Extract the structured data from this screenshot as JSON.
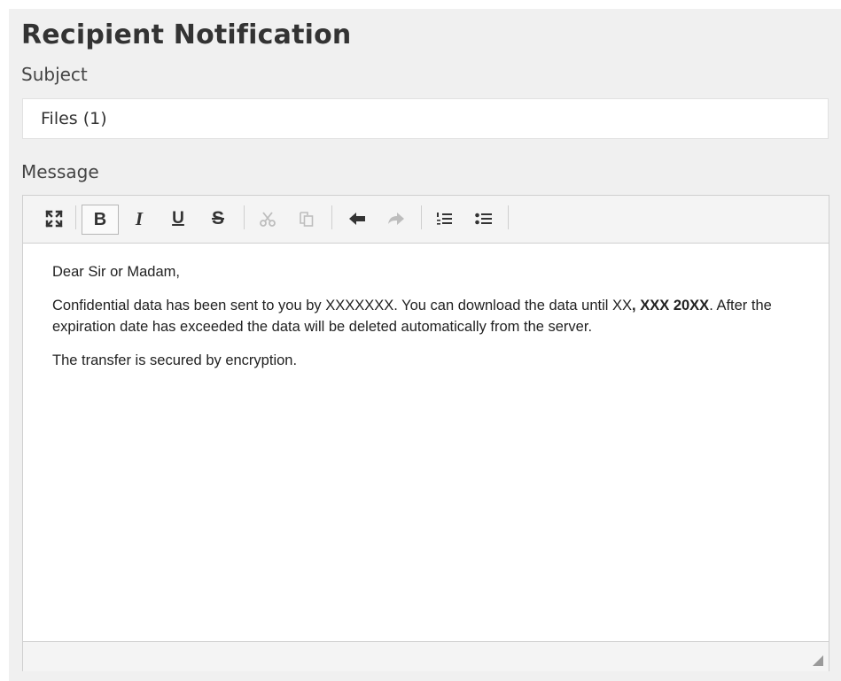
{
  "form": {
    "title": "Recipient Notification",
    "subject_label": "Subject",
    "subject_value": "Files (1)",
    "message_label": "Message"
  },
  "toolbar": {
    "buttons": [
      {
        "name": "fullscreen",
        "icon": "fullscreen-icon",
        "state": "enabled"
      },
      {
        "name": "bold",
        "icon": "bold-icon",
        "label": "B",
        "state": "active"
      },
      {
        "name": "italic",
        "icon": "italic-icon",
        "label": "I",
        "state": "enabled"
      },
      {
        "name": "underline",
        "icon": "underline-icon",
        "label": "U",
        "state": "enabled"
      },
      {
        "name": "strikethrough",
        "icon": "strikethrough-icon",
        "label": "S",
        "state": "enabled"
      },
      {
        "name": "cut",
        "icon": "scissors-icon",
        "state": "disabled"
      },
      {
        "name": "paste",
        "icon": "paste-icon",
        "state": "disabled"
      },
      {
        "name": "undo",
        "icon": "undo-icon",
        "state": "enabled"
      },
      {
        "name": "redo",
        "icon": "redo-icon",
        "state": "disabled"
      },
      {
        "name": "numbered-list",
        "icon": "numbered-list-icon",
        "state": "enabled"
      },
      {
        "name": "bulleted-list",
        "icon": "bulleted-list-icon",
        "state": "enabled"
      }
    ]
  },
  "message": {
    "greeting": "Dear Sir or Madam,",
    "body_part1": "Confidential data has been sent to you by XXXXXXX. You can download the data until XX",
    "body_bold": ", XXX 20XX",
    "body_part2": ". After the expiration date has exceeded the data will be deleted automatically from the server.",
    "closing": "The transfer is secured by encryption."
  },
  "colors": {
    "panel_background": "#f0f0f0",
    "toolbar_background": "#f4f4f4",
    "disabled_icon": "#bdbdbd"
  }
}
